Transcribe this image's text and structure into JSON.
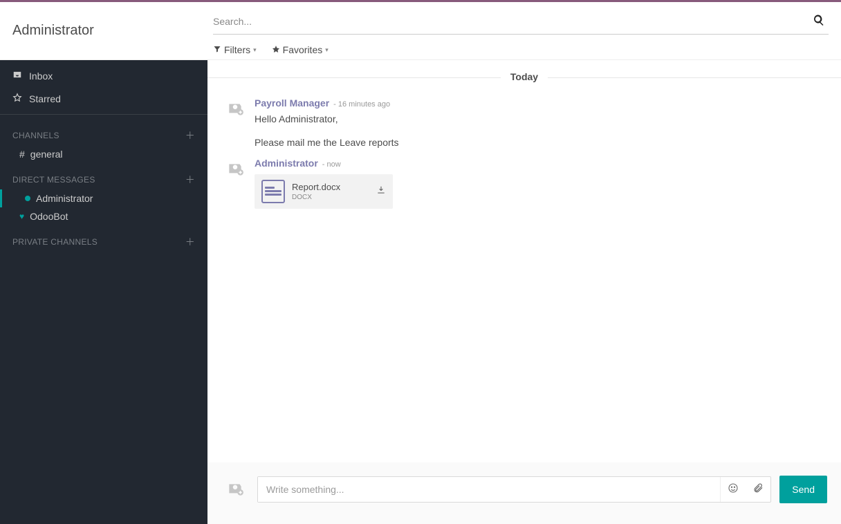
{
  "header": {
    "title": "Administrator"
  },
  "search": {
    "placeholder": "Search..."
  },
  "filters": {
    "filters_label": "Filters",
    "favorites_label": "Favorites"
  },
  "sidebar": {
    "inbox_label": "Inbox",
    "starred_label": "Starred",
    "channels_header": "CHANNELS",
    "channels": [
      {
        "name": "general",
        "prefix": "#"
      }
    ],
    "dm_header": "DIRECT MESSAGES",
    "dms": [
      {
        "name": "Administrator",
        "icon": "dot",
        "active": true
      },
      {
        "name": "OdooBot",
        "icon": "heart",
        "active": false
      }
    ],
    "private_header": "PRIVATE CHANNELS"
  },
  "thread": {
    "day_label": "Today",
    "messages": [
      {
        "author": "Payroll Manager",
        "time": "- 16 minutes ago",
        "lines": [
          "Hello Administrator,",
          "Please mail me the Leave reports"
        ]
      },
      {
        "author": "Administrator",
        "time": "- now",
        "attachment": {
          "name": "Report.docx",
          "ext": "DOCX"
        }
      }
    ]
  },
  "composer": {
    "placeholder": "Write something...",
    "send_label": "Send"
  }
}
